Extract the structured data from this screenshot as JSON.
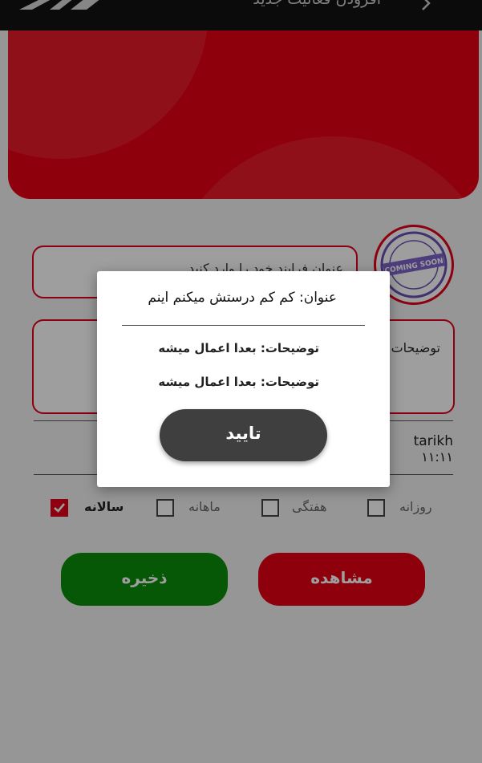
{
  "appbar": {
    "title": "افزودن فعالیت جدید"
  },
  "form": {
    "title_placeholder": "عنوان فرایند خود را وارد کنید",
    "description_label": "توضیحات",
    "date_label": "tarikh",
    "time_value": "۱۱:۱۱",
    "avatar_text": "COMING SOON"
  },
  "frequency": [
    {
      "label": "روزانه",
      "checked": false
    },
    {
      "label": "هفتگی",
      "checked": false
    },
    {
      "label": "ماهانه",
      "checked": false
    },
    {
      "label": "سالانه",
      "checked": true
    }
  ],
  "buttons": {
    "view": "مشاهده",
    "save": "ذخیره"
  },
  "dialog": {
    "title": "عنوان: کم کم درستش میکنم اینم",
    "desc_line_1": "توضیحات: بعدا اعمال میشه",
    "desc_line_2": "توضیحات: بعدا اعمال میشه",
    "confirm": "تایید"
  },
  "colors": {
    "accent": "#e60012",
    "save": "#0a8f0a",
    "dialog_button": "#3f3f3f"
  }
}
